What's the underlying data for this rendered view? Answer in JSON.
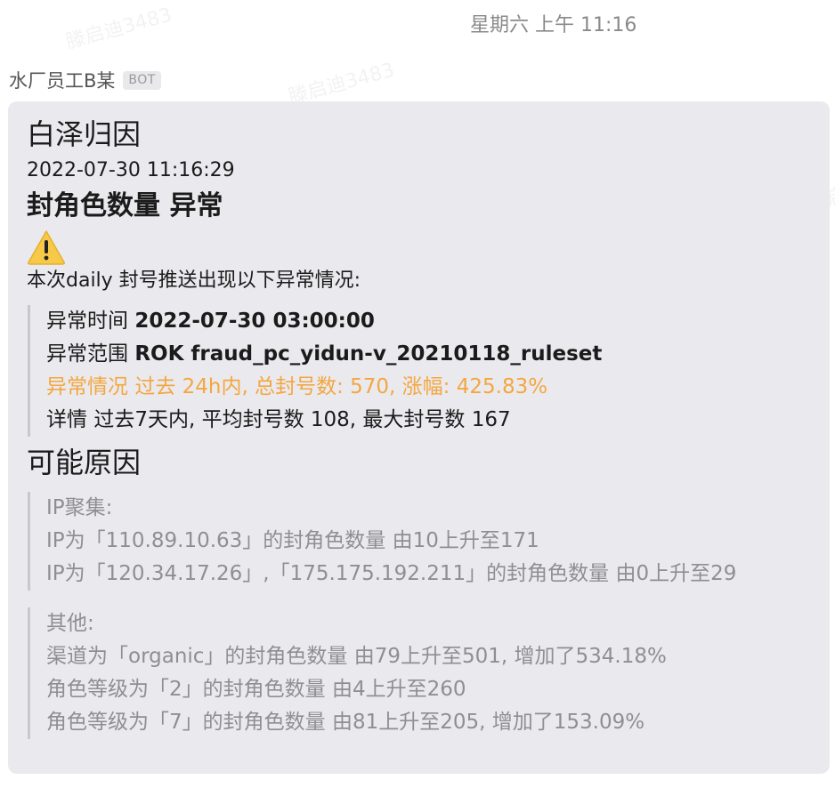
{
  "header": {
    "timestamp": "星期六 上午 11:16"
  },
  "watermark_text": "滕启迪3483",
  "sender": {
    "name": "水厂员工B某",
    "badge": "BOT"
  },
  "message": {
    "title": "白泽归因",
    "datetime": "2022-07-30 11:16:29",
    "heading": "封角色数量 异常",
    "warning_icon": "warning-icon",
    "intro": "本次daily 封号推送出现以下异常情况:",
    "details": {
      "time_label": "异常时间",
      "time_value": "2022-07-30 03:00:00",
      "scope_label": "异常范围",
      "scope_value": "ROK fraud_pc_yidun-v_20210118_ruleset",
      "situation_label": "异常情况",
      "situation_value": "过去 24h内, 总封号数: 570, 涨幅: 425.83%",
      "detail_label": "详情",
      "detail_value": "过去7天内, 平均封号数 108, 最大封号数 167"
    },
    "causes_heading": "可能原因",
    "ip_cluster": {
      "label": "IP聚集:",
      "lines": [
        "IP为「110.89.10.63」的封角色数量 由10上升至171",
        "IP为「120.34.17.26」,「175.175.192.211」的封角色数量 由0上升至29"
      ]
    },
    "others": {
      "label": "其他:",
      "lines": [
        "渠道为「organic」的封角色数量 由79上升至501, 增加了534.18%",
        "角色等级为「2」的封角色数量 由4上升至260",
        "角色等级为「7」的封角色数量 由81上升至205, 增加了153.09%"
      ]
    }
  },
  "colors": {
    "bubble_bg": "#eaeaee",
    "highlight_orange": "#f4a640",
    "muted_gray": "#8e8e93",
    "warning_yellow": "#f7c948"
  }
}
